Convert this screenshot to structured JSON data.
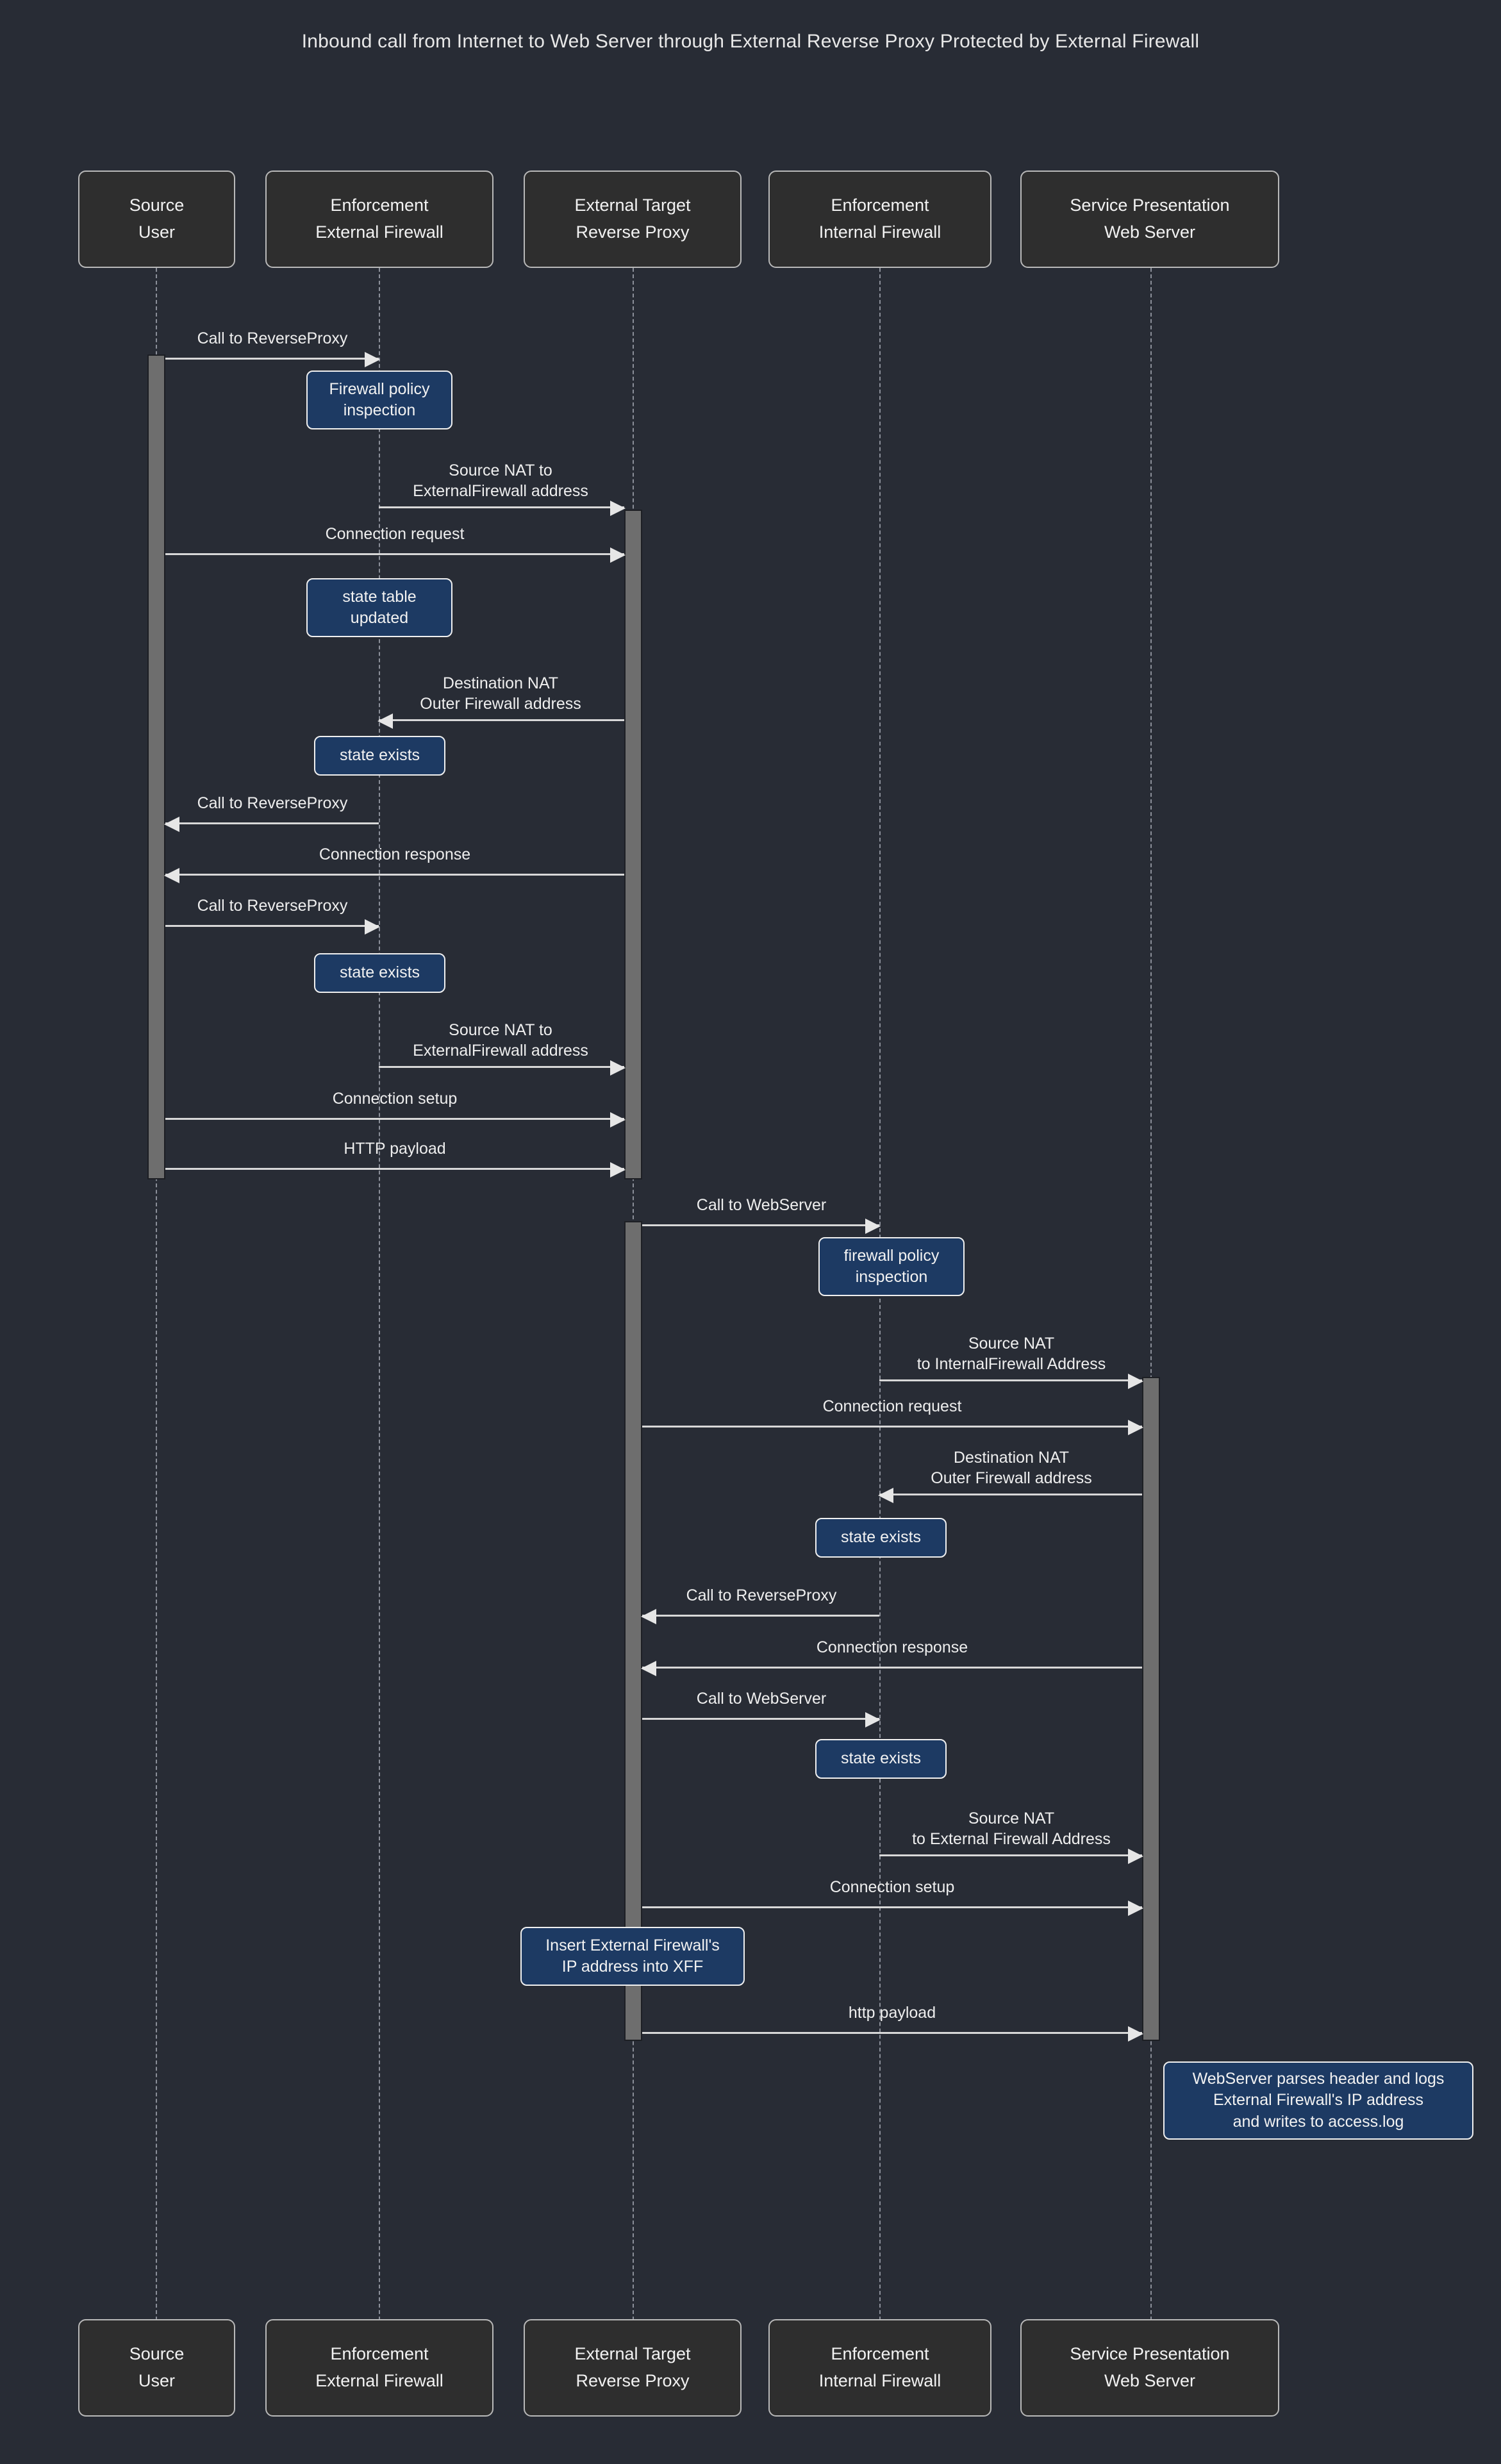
{
  "title": "Inbound call from Internet to Web Server through External Reverse Proxy Protected by External Firewall",
  "theme": {
    "background": "#282c35",
    "participant_fill": "#2e2e2e",
    "participant_border": "#b9b9b9",
    "lifeline": "#8b8f99",
    "activation_fill": "#6e6e6e",
    "note_fill": "#1d3a63",
    "note_border": "#f0f0f0",
    "text": "#f2f2f2",
    "arrow": "#d8d8d8"
  },
  "participants": [
    {
      "id": "user",
      "stereotype": "Source",
      "name": "User"
    },
    {
      "id": "extfw",
      "stereotype": "Enforcement",
      "name": "External Firewall"
    },
    {
      "id": "revproxy",
      "stereotype": "External Target",
      "name": "Reverse Proxy"
    },
    {
      "id": "intfw",
      "stereotype": "Enforcement",
      "name": "Internal Firewall"
    },
    {
      "id": "webserver",
      "stereotype": "Service Presentation",
      "name": "Web Server"
    }
  ],
  "messages": [
    {
      "id": "m1",
      "label": "Call to ReverseProxy",
      "from": "user",
      "to": "extfw",
      "direction": "right"
    },
    {
      "id": "m2",
      "label": "Source NAT to\nExternalFirewall address",
      "from": "extfw",
      "to": "revproxy",
      "direction": "right"
    },
    {
      "id": "m3",
      "label": "Connection request",
      "from": "user",
      "to": "revproxy",
      "direction": "right"
    },
    {
      "id": "m4",
      "label": "Destination NAT\nOuter Firewall address",
      "from": "revproxy",
      "to": "extfw",
      "direction": "left"
    },
    {
      "id": "m5",
      "label": "Call to ReverseProxy",
      "from": "extfw",
      "to": "user",
      "direction": "left"
    },
    {
      "id": "m6",
      "label": "Connection response",
      "from": "revproxy",
      "to": "user",
      "direction": "left"
    },
    {
      "id": "m7",
      "label": "Call to ReverseProxy",
      "from": "user",
      "to": "extfw",
      "direction": "right"
    },
    {
      "id": "m8",
      "label": "Source NAT to\nExternalFirewall address",
      "from": "extfw",
      "to": "revproxy",
      "direction": "right"
    },
    {
      "id": "m9",
      "label": "Connection setup",
      "from": "user",
      "to": "revproxy",
      "direction": "right"
    },
    {
      "id": "m10",
      "label": "HTTP payload",
      "from": "user",
      "to": "revproxy",
      "direction": "right"
    },
    {
      "id": "m11",
      "label": "Call to WebServer",
      "from": "revproxy",
      "to": "intfw",
      "direction": "right"
    },
    {
      "id": "m12",
      "label": "Source NAT\nto InternalFirewall Address",
      "from": "intfw",
      "to": "webserver",
      "direction": "right"
    },
    {
      "id": "m13",
      "label": "Connection request",
      "from": "revproxy",
      "to": "webserver",
      "direction": "right"
    },
    {
      "id": "m14",
      "label": "Destination NAT\nOuter Firewall address",
      "from": "webserver",
      "to": "intfw",
      "direction": "left"
    },
    {
      "id": "m15",
      "label": "Call to ReverseProxy",
      "from": "intfw",
      "to": "revproxy",
      "direction": "left"
    },
    {
      "id": "m16",
      "label": "Connection response",
      "from": "webserver",
      "to": "revproxy",
      "direction": "left"
    },
    {
      "id": "m17",
      "label": "Call to WebServer",
      "from": "revproxy",
      "to": "intfw",
      "direction": "right"
    },
    {
      "id": "m18",
      "label": "Source NAT\nto External Firewall Address",
      "from": "intfw",
      "to": "webserver",
      "direction": "right"
    },
    {
      "id": "m19",
      "label": "Connection setup",
      "from": "revproxy",
      "to": "webserver",
      "direction": "right"
    },
    {
      "id": "m20",
      "label": "http payload",
      "from": "revproxy",
      "to": "webserver",
      "direction": "right"
    }
  ],
  "notes": [
    {
      "id": "n1",
      "text": "Firewall policy\ninspection",
      "on": "extfw"
    },
    {
      "id": "n2",
      "text": "state table\nupdated",
      "on": "extfw"
    },
    {
      "id": "n3",
      "text": "state exists",
      "on": "extfw"
    },
    {
      "id": "n4",
      "text": "state exists",
      "on": "extfw"
    },
    {
      "id": "n5",
      "text": "firewall policy\ninspection",
      "on": "intfw"
    },
    {
      "id": "n6",
      "text": "state exists",
      "on": "intfw"
    },
    {
      "id": "n7",
      "text": "state exists",
      "on": "intfw"
    },
    {
      "id": "n8",
      "text": "Insert External Firewall's\nIP address into XFF",
      "on": "revproxy"
    },
    {
      "id": "n9",
      "text": "WebServer parses header and logs\nExternal Firewall's IP address\n and writes to access.log",
      "on": "webserver"
    }
  ]
}
